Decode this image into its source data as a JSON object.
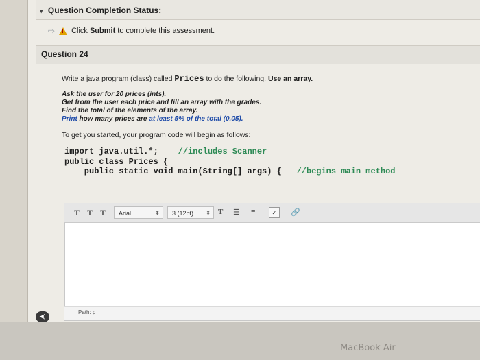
{
  "status": {
    "title": "Question Completion Status:"
  },
  "notice": {
    "prefix": "Click ",
    "action": "Submit",
    "suffix": " to complete this assessment."
  },
  "question": {
    "title": "Question 24",
    "intro_prefix": "Write a java program (class) called ",
    "class_name": "Prices",
    "intro_mid": " to do the following. ",
    "intro_emph": "Use an array.",
    "instructions": [
      "Ask the user for 20 prices (ints).",
      "Get from the user each price and fill an array with the grades.",
      "Find the total of the elements of the array."
    ],
    "instruction_last": {
      "prefix": "Print",
      "middle": " how many prices are ",
      "highlight": "at least 5% of the total (0.05)."
    },
    "code_intro": "To get you started, your program code will begin as follows:",
    "code": [
      {
        "code": "import java.util.*;",
        "comment": "//includes Scanner"
      },
      {
        "code": "public class Prices {",
        "comment": ""
      },
      {
        "code": "    public static void main(String[] args) {",
        "comment": "//begins main method"
      }
    ]
  },
  "editor": {
    "toolbar": {
      "buttons": [
        "T",
        "T",
        "T"
      ],
      "font_family": "Arial",
      "font_size": "3 (12pt)"
    },
    "path_label": "Path: p"
  },
  "bezel": {
    "brand": "MacBook Air"
  }
}
